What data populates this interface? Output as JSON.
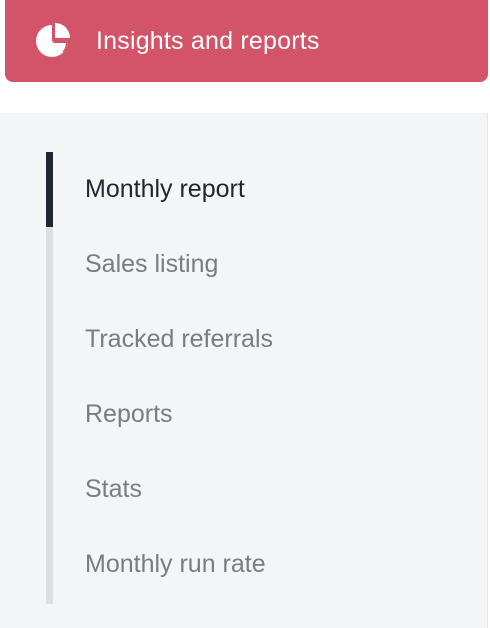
{
  "header": {
    "title": "Insights and reports",
    "icon": "pie-chart-icon",
    "color": "#d35468"
  },
  "nav": {
    "active_index": 0,
    "items": [
      {
        "label": "Monthly report",
        "active": true
      },
      {
        "label": "Sales listing",
        "active": false
      },
      {
        "label": "Tracked referrals",
        "active": false
      },
      {
        "label": "Reports",
        "active": false
      },
      {
        "label": "Stats",
        "active": false
      },
      {
        "label": "Monthly run rate",
        "active": false
      }
    ]
  },
  "colors": {
    "active_text": "#1f2630",
    "inactive_text": "#797c82",
    "panel_background": "#f4f5f7",
    "indicator": "#1f2630",
    "track": "#dcdee2"
  }
}
